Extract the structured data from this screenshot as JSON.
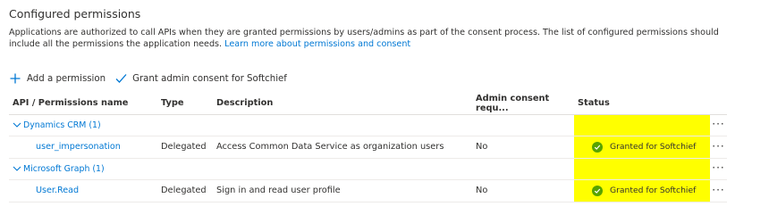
{
  "section": {
    "title": "Configured permissions",
    "description": "Applications are authorized to call APIs when they are granted permissions by users/admins as part of the consent process. The list of configured permissions should include all the permissions the application needs.",
    "learn_more": "Learn more about permissions and consent"
  },
  "toolbar": {
    "add_label": "Add a permission",
    "grant_label": "Grant admin consent for Softchief"
  },
  "table": {
    "headers": {
      "name": "API / Permissions name",
      "type": "Type",
      "description": "Description",
      "admin": "Admin consent requ...",
      "status": "Status"
    },
    "groups": [
      {
        "label": "Dynamics CRM (1)",
        "permission": {
          "name": "user_impersonation",
          "type": "Delegated",
          "description": "Access Common Data Service as organization users",
          "admin": "No",
          "status": "Granted for Softchief"
        }
      },
      {
        "label": "Microsoft Graph (1)",
        "permission": {
          "name": "User.Read",
          "type": "Delegated",
          "description": "Sign in and read user profile",
          "admin": "No",
          "status": "Granted for Softchief"
        }
      }
    ]
  },
  "more_label": "···",
  "colors": {
    "accent": "#0078d4",
    "highlight": "#ffff00",
    "granted": "#57a300"
  },
  "icons": [
    "plus-icon",
    "checkmark-icon",
    "chevron-down-icon",
    "success-check-icon",
    "more-icon"
  ]
}
